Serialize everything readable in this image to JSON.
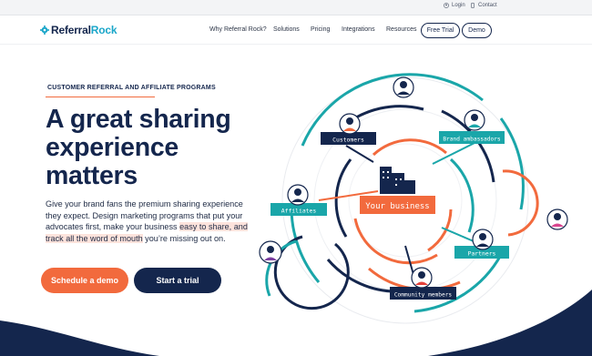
{
  "topbar": {
    "login_label": "Login",
    "contact_label": "Contact"
  },
  "nav": {
    "logo_part1": "Referral",
    "logo_part2": "Rock",
    "links": [
      "Why Referral Rock?",
      "Solutions",
      "Pricing",
      "Integrations",
      "Resources"
    ],
    "free_trial_label": "Free Trial",
    "demo_label": "Demo"
  },
  "hero": {
    "eyebrow": "CUSTOMER REFERRAL AND AFFILIATE PROGRAMS",
    "title": "A great sharing experience matters",
    "body_part1": "Give your brand fans the premium sharing experience they expect. Design marketing programs that put your advocates first, make your business ",
    "body_highlight": "easy to share, and track all the word of mouth",
    "body_part2": " you’re missing out on.",
    "cta_demo": "Schedule a demo",
    "cta_trial": "Start a trial"
  },
  "illustration": {
    "center_label": "Your business",
    "labels": {
      "customers": "Customers",
      "brand_ambassadors": "Brand ambassadors",
      "affiliates": "Affiliates",
      "partners": "Partners",
      "community_members": "Community members"
    }
  },
  "colors": {
    "navy": "#14264d",
    "orange": "#f26a3d",
    "teal": "#1aa6a9",
    "logo_accent": "#1aa6c9"
  }
}
